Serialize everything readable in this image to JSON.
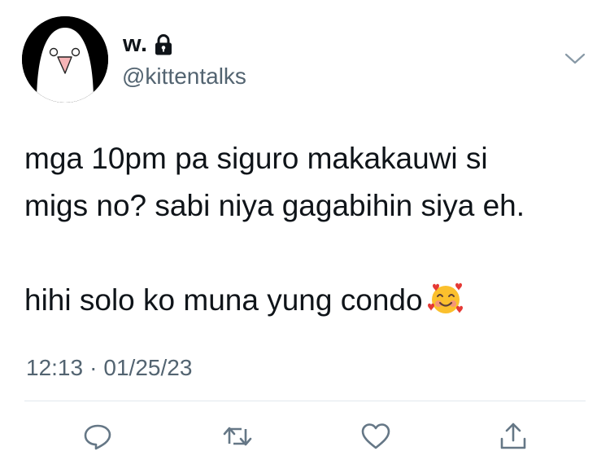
{
  "user": {
    "display_name": "w.",
    "handle": "@kittentalks",
    "avatar_icon": "ghost-avatar",
    "protected_icon": "lock-icon"
  },
  "tweet": {
    "lines": [
      "mga 10pm pa siguro makakauwi si",
      "migs no? sabi niya gagabihin siya eh.",
      "hihi solo ko muna yung condo"
    ],
    "emoji": "smiling-face-with-hearts",
    "time": "12:13",
    "separator": "·",
    "date": "01/25/23"
  },
  "actions": [
    {
      "name": "reply",
      "icon": "reply-icon"
    },
    {
      "name": "retweet",
      "icon": "retweet-icon"
    },
    {
      "name": "like",
      "icon": "heart-icon"
    },
    {
      "name": "share",
      "icon": "share-icon"
    }
  ],
  "colors": {
    "text": "#0f1419",
    "secondary": "#536471",
    "divider": "#e1e8ed",
    "icon": "#657786"
  }
}
